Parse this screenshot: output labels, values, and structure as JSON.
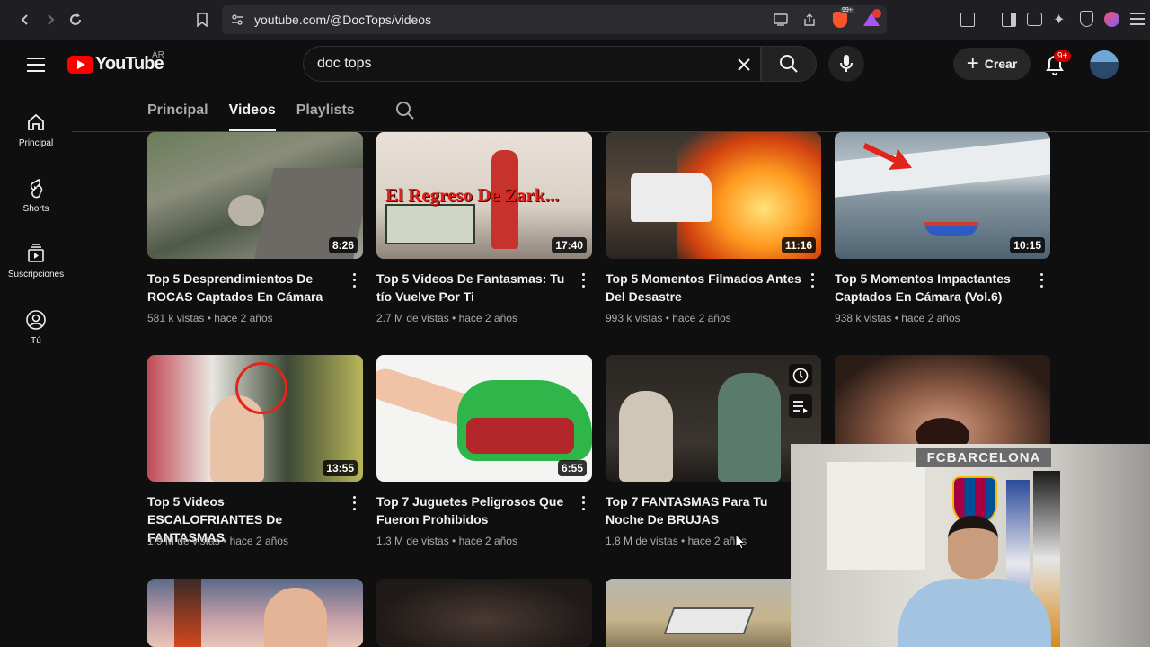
{
  "browser": {
    "url": "youtube.com/@DocTops/videos"
  },
  "header": {
    "logo_text": "YouTube",
    "country_code": "AR",
    "search_value": "doc tops",
    "create_label": "Crear",
    "notification_count": "9+",
    "extension_badge": "99+"
  },
  "sidebar": {
    "items": [
      {
        "label": "Principal",
        "icon": "home-icon"
      },
      {
        "label": "Shorts",
        "icon": "shorts-icon"
      },
      {
        "label": "Suscripciones",
        "icon": "subscriptions-icon"
      },
      {
        "label": "Tú",
        "icon": "you-icon"
      }
    ]
  },
  "tabs": [
    {
      "label": "Principal",
      "active": false
    },
    {
      "label": "Videos",
      "active": true
    },
    {
      "label": "Playlists",
      "active": false
    }
  ],
  "videos": [
    {
      "title": "Top 5 Desprendimientos De ROCAS Captados En Cámara",
      "duration": "8:26",
      "views": "581 k vistas",
      "age": "hace 2 años"
    },
    {
      "title": "Top 5 Videos De Fantasmas: Tu tío Vuelve Por Ti",
      "duration": "17:40",
      "views": "2.7 M de vistas",
      "age": "hace 2 años",
      "thumb_text": "El Regreso De Zark..."
    },
    {
      "title": "Top 5 Momentos Filmados Antes Del Desastre",
      "duration": "11:16",
      "views": "993 k vistas",
      "age": "hace 2 años"
    },
    {
      "title": "Top 5 Momentos Impactantes Captados En Cámara (Vol.6)",
      "duration": "10:15",
      "views": "938 k vistas",
      "age": "hace 2 años"
    },
    {
      "title": "Top 5 Videos ESCALOFRIANTES De FANTASMAS",
      "duration": "13:55",
      "views": "1.9 M de vistas",
      "age": "hace 2 años"
    },
    {
      "title": "Top 7 Juguetes Peligrosos Que Fueron Prohibidos",
      "duration": "6:55",
      "views": "1.3 M de vistas",
      "age": "hace 2 años"
    },
    {
      "title": "Top 7 FANTASMAS Para Tu Noche De BRUJAS",
      "duration": "",
      "views": "1.8 M de vistas",
      "age": "hace 2 años"
    },
    {
      "title": "",
      "duration": "",
      "views": "",
      "age": ""
    }
  ],
  "webcam": {
    "banner_text": "FCBARCELONA"
  }
}
